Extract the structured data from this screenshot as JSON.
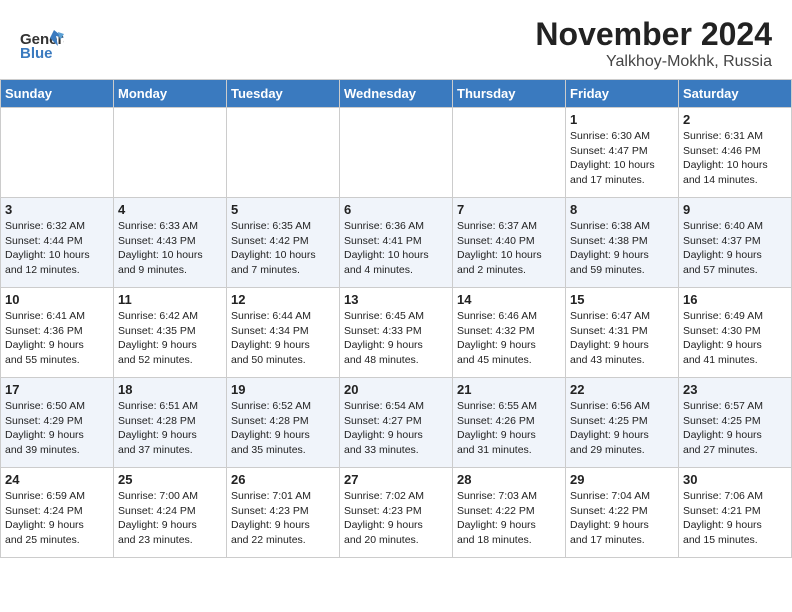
{
  "header": {
    "logo_line1": "General",
    "logo_line2": "Blue",
    "title": "November 2024",
    "subtitle": "Yalkhoy-Mokhk, Russia"
  },
  "calendar": {
    "days_of_week": [
      "Sunday",
      "Monday",
      "Tuesday",
      "Wednesday",
      "Thursday",
      "Friday",
      "Saturday"
    ],
    "weeks": [
      [
        {
          "day": "",
          "info": ""
        },
        {
          "day": "",
          "info": ""
        },
        {
          "day": "",
          "info": ""
        },
        {
          "day": "",
          "info": ""
        },
        {
          "day": "",
          "info": ""
        },
        {
          "day": "1",
          "info": "Sunrise: 6:30 AM\nSunset: 4:47 PM\nDaylight: 10 hours\nand 17 minutes."
        },
        {
          "day": "2",
          "info": "Sunrise: 6:31 AM\nSunset: 4:46 PM\nDaylight: 10 hours\nand 14 minutes."
        }
      ],
      [
        {
          "day": "3",
          "info": "Sunrise: 6:32 AM\nSunset: 4:44 PM\nDaylight: 10 hours\nand 12 minutes."
        },
        {
          "day": "4",
          "info": "Sunrise: 6:33 AM\nSunset: 4:43 PM\nDaylight: 10 hours\nand 9 minutes."
        },
        {
          "day": "5",
          "info": "Sunrise: 6:35 AM\nSunset: 4:42 PM\nDaylight: 10 hours\nand 7 minutes."
        },
        {
          "day": "6",
          "info": "Sunrise: 6:36 AM\nSunset: 4:41 PM\nDaylight: 10 hours\nand 4 minutes."
        },
        {
          "day": "7",
          "info": "Sunrise: 6:37 AM\nSunset: 4:40 PM\nDaylight: 10 hours\nand 2 minutes."
        },
        {
          "day": "8",
          "info": "Sunrise: 6:38 AM\nSunset: 4:38 PM\nDaylight: 9 hours\nand 59 minutes."
        },
        {
          "day": "9",
          "info": "Sunrise: 6:40 AM\nSunset: 4:37 PM\nDaylight: 9 hours\nand 57 minutes."
        }
      ],
      [
        {
          "day": "10",
          "info": "Sunrise: 6:41 AM\nSunset: 4:36 PM\nDaylight: 9 hours\nand 55 minutes."
        },
        {
          "day": "11",
          "info": "Sunrise: 6:42 AM\nSunset: 4:35 PM\nDaylight: 9 hours\nand 52 minutes."
        },
        {
          "day": "12",
          "info": "Sunrise: 6:44 AM\nSunset: 4:34 PM\nDaylight: 9 hours\nand 50 minutes."
        },
        {
          "day": "13",
          "info": "Sunrise: 6:45 AM\nSunset: 4:33 PM\nDaylight: 9 hours\nand 48 minutes."
        },
        {
          "day": "14",
          "info": "Sunrise: 6:46 AM\nSunset: 4:32 PM\nDaylight: 9 hours\nand 45 minutes."
        },
        {
          "day": "15",
          "info": "Sunrise: 6:47 AM\nSunset: 4:31 PM\nDaylight: 9 hours\nand 43 minutes."
        },
        {
          "day": "16",
          "info": "Sunrise: 6:49 AM\nSunset: 4:30 PM\nDaylight: 9 hours\nand 41 minutes."
        }
      ],
      [
        {
          "day": "17",
          "info": "Sunrise: 6:50 AM\nSunset: 4:29 PM\nDaylight: 9 hours\nand 39 minutes."
        },
        {
          "day": "18",
          "info": "Sunrise: 6:51 AM\nSunset: 4:28 PM\nDaylight: 9 hours\nand 37 minutes."
        },
        {
          "day": "19",
          "info": "Sunrise: 6:52 AM\nSunset: 4:28 PM\nDaylight: 9 hours\nand 35 minutes."
        },
        {
          "day": "20",
          "info": "Sunrise: 6:54 AM\nSunset: 4:27 PM\nDaylight: 9 hours\nand 33 minutes."
        },
        {
          "day": "21",
          "info": "Sunrise: 6:55 AM\nSunset: 4:26 PM\nDaylight: 9 hours\nand 31 minutes."
        },
        {
          "day": "22",
          "info": "Sunrise: 6:56 AM\nSunset: 4:25 PM\nDaylight: 9 hours\nand 29 minutes."
        },
        {
          "day": "23",
          "info": "Sunrise: 6:57 AM\nSunset: 4:25 PM\nDaylight: 9 hours\nand 27 minutes."
        }
      ],
      [
        {
          "day": "24",
          "info": "Sunrise: 6:59 AM\nSunset: 4:24 PM\nDaylight: 9 hours\nand 25 minutes."
        },
        {
          "day": "25",
          "info": "Sunrise: 7:00 AM\nSunset: 4:24 PM\nDaylight: 9 hours\nand 23 minutes."
        },
        {
          "day": "26",
          "info": "Sunrise: 7:01 AM\nSunset: 4:23 PM\nDaylight: 9 hours\nand 22 minutes."
        },
        {
          "day": "27",
          "info": "Sunrise: 7:02 AM\nSunset: 4:23 PM\nDaylight: 9 hours\nand 20 minutes."
        },
        {
          "day": "28",
          "info": "Sunrise: 7:03 AM\nSunset: 4:22 PM\nDaylight: 9 hours\nand 18 minutes."
        },
        {
          "day": "29",
          "info": "Sunrise: 7:04 AM\nSunset: 4:22 PM\nDaylight: 9 hours\nand 17 minutes."
        },
        {
          "day": "30",
          "info": "Sunrise: 7:06 AM\nSunset: 4:21 PM\nDaylight: 9 hours\nand 15 minutes."
        }
      ]
    ]
  }
}
